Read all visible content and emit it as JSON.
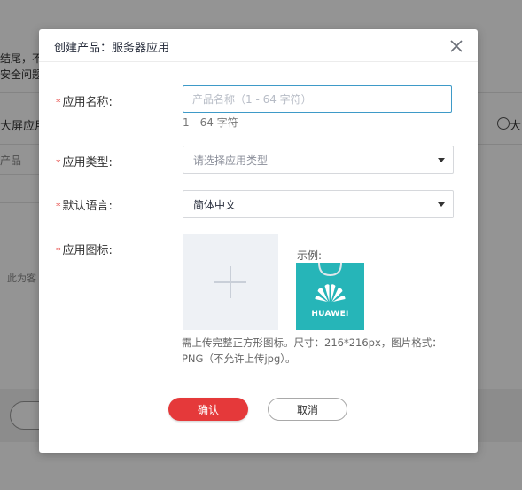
{
  "background": {
    "fragment_1": "结尾，不",
    "fragment_2": "安全问题",
    "fragment_3": "大屏应用",
    "fragment_4": "产品",
    "fragment_5": "此为客",
    "fragment_6": "大"
  },
  "dialog": {
    "title": "创建产品：服务器应用",
    "required_mark": "*",
    "app_name": {
      "label": "应用名称:",
      "placeholder": "产品名称（1 - 64 字符）",
      "value": "",
      "hint": "1 - 64 字符"
    },
    "app_type": {
      "label": "应用类型:",
      "placeholder": "请选择应用类型"
    },
    "default_language": {
      "label": "默认语言:",
      "value": "简体中文"
    },
    "app_icon": {
      "label": "应用图标:",
      "example_label": "示例:",
      "example_brand": "HUAWEI",
      "note": "需上传完整正方形图标。尺寸：216*216px，图片格式：PNG（不允许上传jpg）。"
    },
    "confirm_label": "确认",
    "cancel_label": "取消"
  },
  "colors": {
    "accent": "#e5393a",
    "input_focus_border": "#3e9ac8",
    "example_bg": "#26b5b8"
  },
  "icons": {
    "close": "close-icon",
    "upload": "plus-icon",
    "dropdown": "caret-down-icon"
  }
}
